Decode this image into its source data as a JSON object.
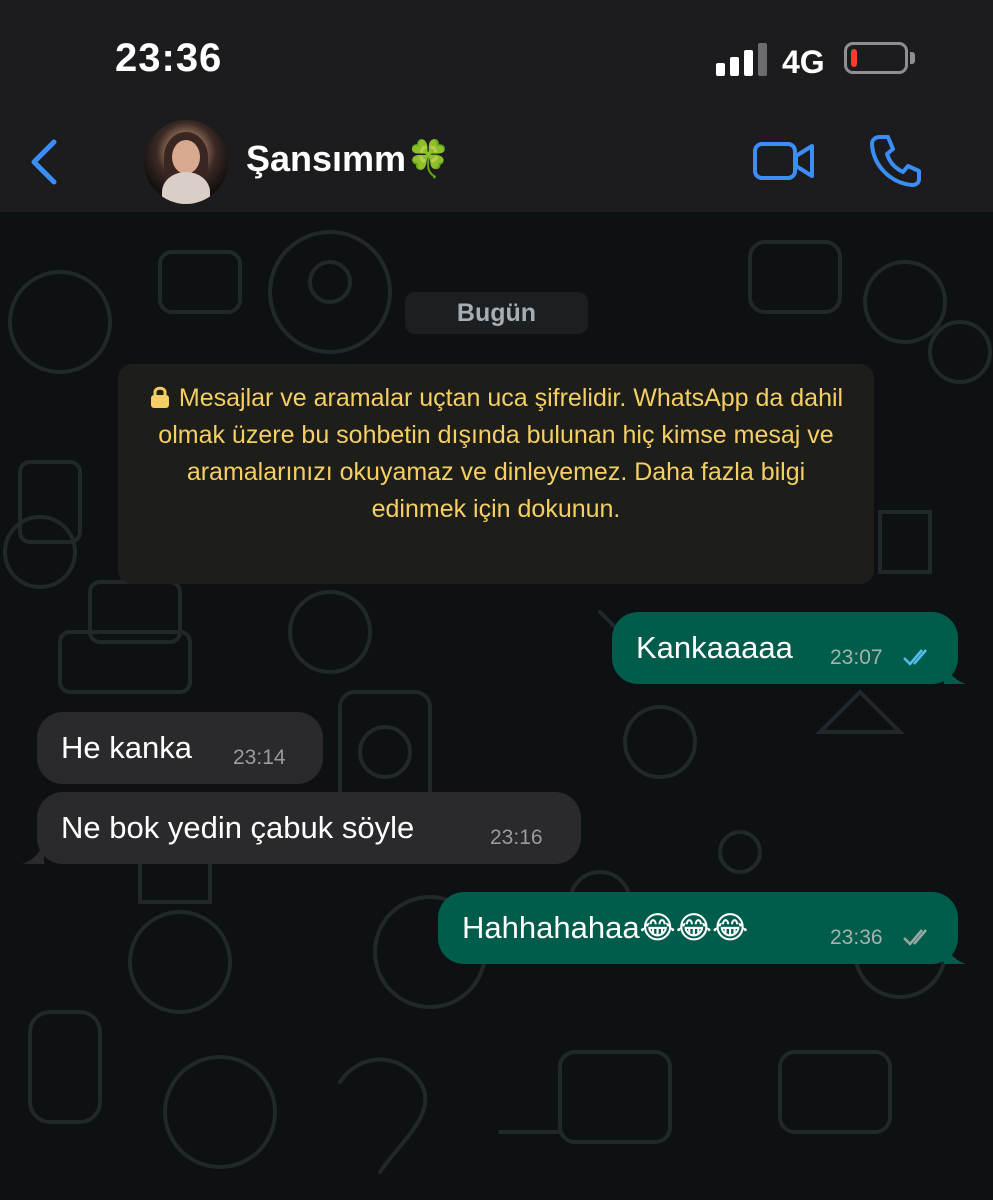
{
  "status_bar": {
    "time": "23:36",
    "network": "4G",
    "battery_level": 0.12,
    "signal_bars": 3
  },
  "header": {
    "contact_name": "Şansımm🍀",
    "back_icon": "chevron-left-icon",
    "video_icon": "video-camera-icon",
    "call_icon": "phone-icon",
    "accent": "#3a8ef6"
  },
  "chat": {
    "date_label": "Bugün",
    "encryption_notice": "Mesajlar ve aramalar uçtan uca şifrelidir. WhatsApp da dahil olmak üzere bu sohbetin dışında bulunan hiç kimse mesaj ve aramalarınızı okuyamaz ve dinleyemez. Daha fazla bilgi edinmek için dokunun.",
    "notice_color": "#f5cf63",
    "messages": [
      {
        "direction": "out",
        "text": "Kankaaaaa",
        "time": "23:07",
        "status": "read"
      },
      {
        "direction": "in",
        "text": "He kanka",
        "time": "23:14"
      },
      {
        "direction": "in",
        "text": "Ne bok yedin çabuk söyle",
        "time": "23:16"
      },
      {
        "direction": "out",
        "text": "Hahhahahaa😂😂😂",
        "time": "23:36",
        "status": "delivered"
      }
    ],
    "outgoing_color": "#005c4b",
    "incoming_color": "#2a2a2d"
  }
}
